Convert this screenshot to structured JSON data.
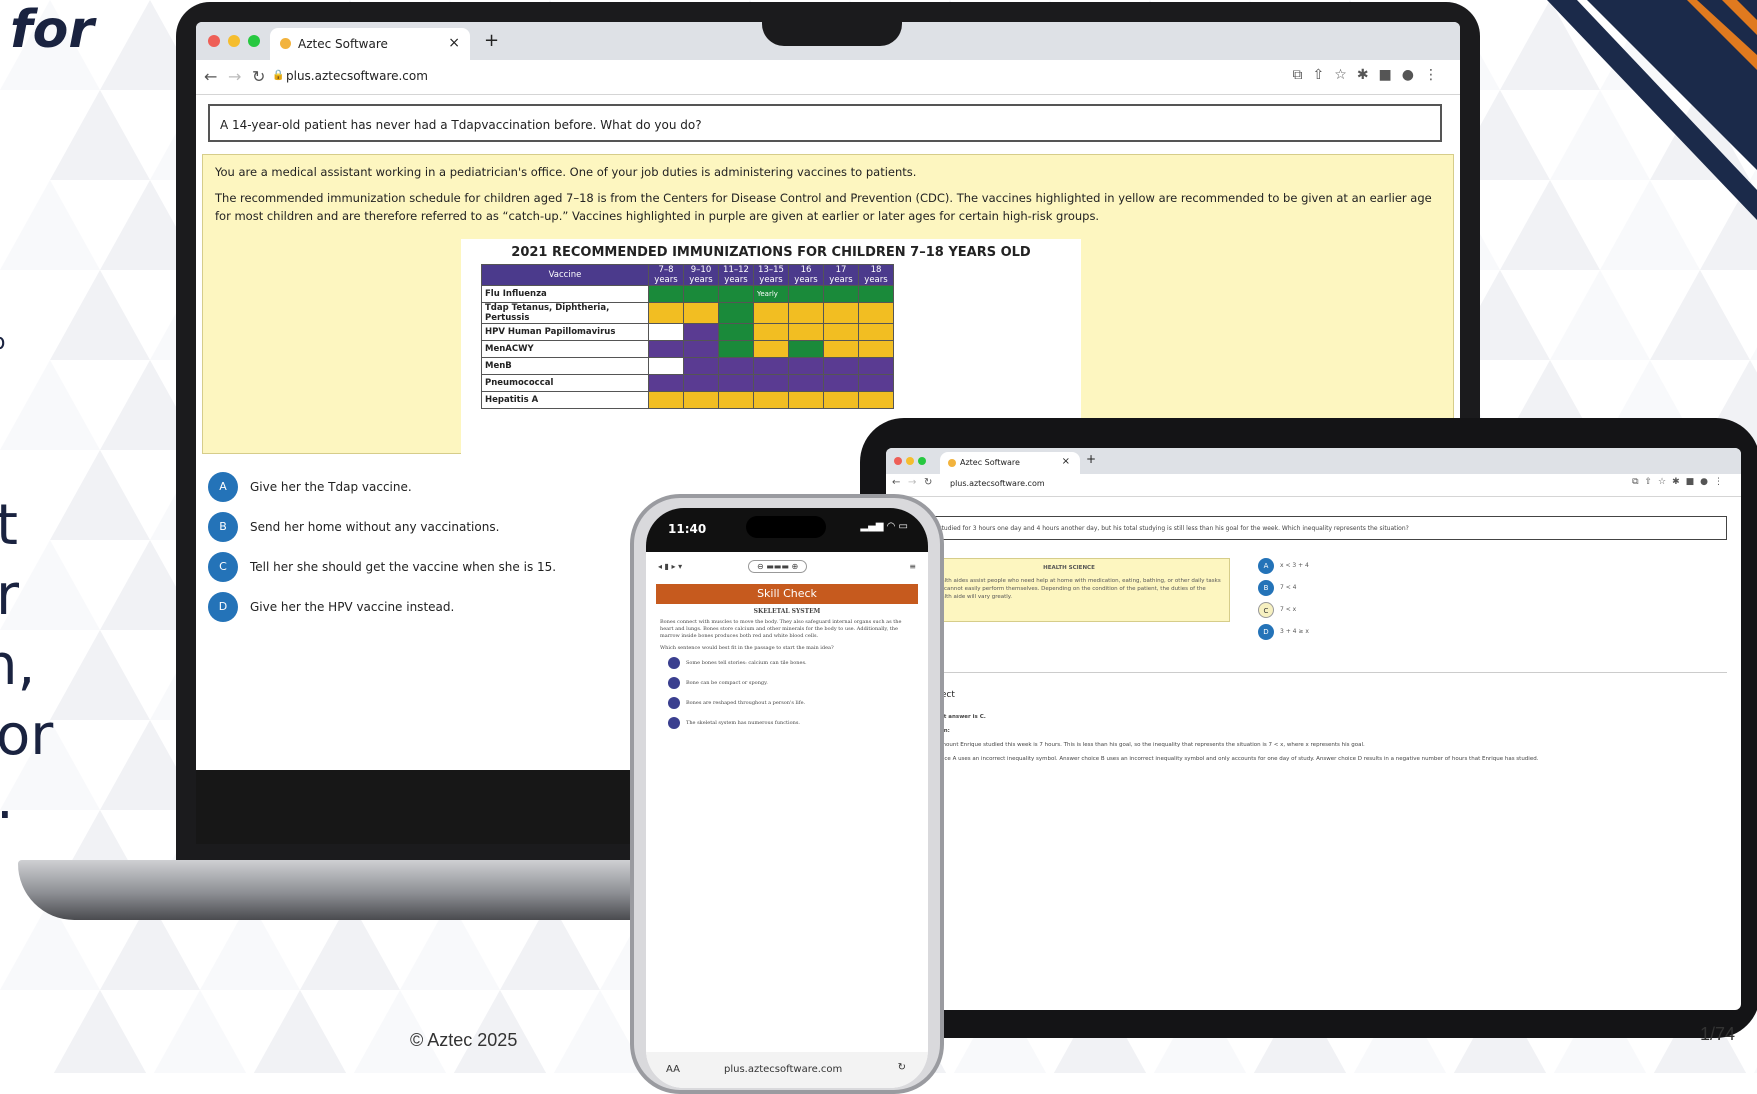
{
  "slide": {
    "fragment_top": "for",
    "fragment_small": "o",
    "fragment_lines": [
      "t",
      "r",
      "n,",
      "or",
      "."
    ],
    "footer": "© Aztec 2025",
    "page_number": "1/74"
  },
  "laptop": {
    "tab_title": "Aztec Software",
    "tab_close": "×",
    "new_tab": "+",
    "url": "plus.aztecsoftware.com",
    "question": "A 14-year-old patient has never had a Tdapvaccination before. What do you do?",
    "passage": [
      "You are a medical assistant working in a pediatrician's office. One of your job duties is administering vaccines to patients.",
      "The recommended immunization schedule for children aged 7–18 is from the Centers for Disease Control and Prevention (CDC). The vaccines highlighted in yellow are recommended to be given at an earlier age for most children and are therefore referred to as “catch-up.” Vaccines highlighted in purple are given at earlier or later ages for certain high-risk groups."
    ],
    "immunization_table": {
      "title": "2021 RECOMMENDED IMMUNIZATIONS FOR CHILDREN 7–18 YEARS OLD",
      "header": [
        "Vaccine",
        "7–8 years",
        "9–10 years",
        "11–12 years",
        "13–15 years",
        "16 years",
        "17 years",
        "18 years"
      ],
      "rows": [
        {
          "name": "Flu Influenza",
          "cells": [
            "g",
            "g",
            "g",
            "g",
            "g",
            "g",
            "g"
          ],
          "note": "Yearly"
        },
        {
          "name": "Tdap Tetanus, Diphtheria, Pertussis",
          "cells": [
            "y",
            "y",
            "g",
            "y",
            "y",
            "y",
            "y"
          ]
        },
        {
          "name": "HPV Human Papillomavirus",
          "cells": [
            "w",
            "p",
            "g",
            "y",
            "y",
            "y",
            "y"
          ]
        },
        {
          "name": "MenACWY",
          "cells": [
            "p",
            "p",
            "g",
            "y",
            "g",
            "y",
            "y"
          ]
        },
        {
          "name": "MenB",
          "cells": [
            "w",
            "p",
            "p",
            "p",
            "p",
            "p",
            "p"
          ]
        },
        {
          "name": "Pneumococcal",
          "cells": [
            "p",
            "p",
            "p",
            "p",
            "p",
            "p",
            "p"
          ]
        },
        {
          "name": "Hepatitis A",
          "cells": [
            "y",
            "y",
            "y",
            "y",
            "y",
            "y",
            "y"
          ]
        }
      ]
    },
    "answers": [
      {
        "letter": "A",
        "text": "Give her the Tdap vaccine."
      },
      {
        "letter": "B",
        "text": "Send her home without any vaccinations."
      },
      {
        "letter": "C",
        "text": "Tell her she should get the vaccine when she is 15."
      },
      {
        "letter": "D",
        "text": "Give her the HPV vaccine instead."
      }
    ]
  },
  "tablet": {
    "tab_title": "Aztec Software",
    "url": "plus.aztecsoftware.com",
    "question": "Enrique has studied for 3 hours one day and 4 hours another day, but his total studying is still less than his goal for the week. Which inequality represents the situation?",
    "passage_heading": "HEALTH SCIENCE",
    "passage_body": "Some health aides assist people who need help at home with medication, eating, bathing, or other daily tasks that they cannot easily perform themselves. Depending on the condition of the patient, the duties of the home health aide will vary greatly.",
    "answers": [
      {
        "letter": "A",
        "text": "x < 3 + 4"
      },
      {
        "letter": "B",
        "text": "7 < 4"
      },
      {
        "letter": "C",
        "text": "7 < x"
      },
      {
        "letter": "D",
        "text": "3 + 4 ≥ x"
      }
    ],
    "result": "Correct",
    "explanation": [
      "The correct answer is C.",
      "Explanation:",
      "The total amount Enrique studied this week is 7 hours. This is less than his goal, so the inequality that represents the situation is 7 < x, where x represents his goal.",
      "Answer choice A uses an incorrect inequality symbol. Answer choice B uses an incorrect inequality symbol and only accounts for one day of study. Answer choice D results in a negative number of hours that Enrique has studied."
    ]
  },
  "phone": {
    "time": "11:40",
    "heading": "Skill Check",
    "passage_title": "SKELETAL SYSTEM",
    "passage": "Bones connect with muscles to move the body. They also safeguard internal organs such as the heart and lungs. Bones store calcium and other minerals for the body to use. Additionally, the marrow inside bones produces both red and white blood cells.",
    "prompt": "Which sentence would best fit in the passage to start the main idea?",
    "options": [
      "Some bones tell stories: calcium can tile bones.",
      "Bone can be compact or spongy.",
      "Bones are reshaped throughout a person's life.",
      "The skeletal system has numerous functions."
    ],
    "url": "plus.aztecsoftware.com",
    "aa": "AA"
  }
}
